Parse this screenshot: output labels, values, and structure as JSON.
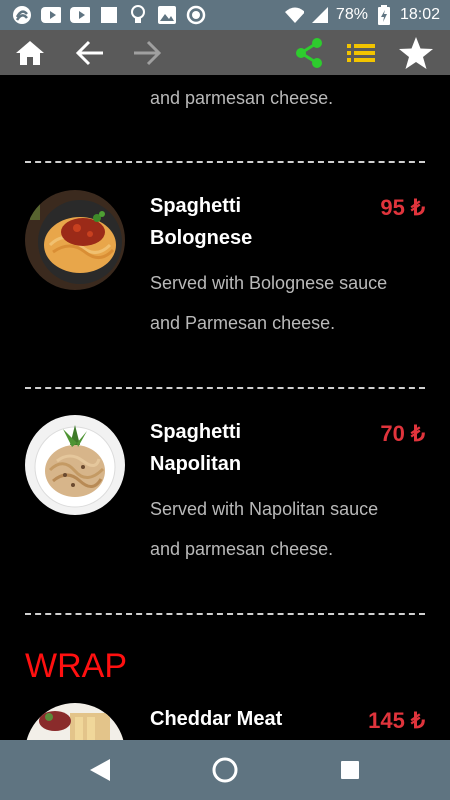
{
  "status_bar": {
    "battery": "78%",
    "time": "18:02"
  },
  "toolbar": {
    "icons": [
      "home-icon",
      "back-arrow-icon",
      "forward-arrow-icon",
      "share-icon",
      "list-icon",
      "star-icon"
    ],
    "colors": {
      "share": "#2ecc2e",
      "list": "#f2c400",
      "icon": "#ffffff",
      "disabled": "#a0a0a0"
    }
  },
  "menu": {
    "prev_item_desc_tail": "and parmesan cheese.",
    "items": [
      {
        "name_line1": "Spaghetti",
        "name_line2": "Bolognese",
        "price": "95 ₺",
        "desc_line1": "Served with Bolognese sauce",
        "desc_line2": "and Parmesan cheese."
      },
      {
        "name_line1": "Spaghetti",
        "name_line2": "Napolitan",
        "price": "70 ₺",
        "desc_line1": "Served with Napolitan sauce",
        "desc_line2": "and parmesan cheese."
      }
    ],
    "section_wrap": {
      "title": "WRAP",
      "first_item": {
        "name_line1": "Cheddar Meat",
        "price": "145 ₺"
      }
    }
  },
  "nav_bar": {
    "icons": [
      "back-triangle-icon",
      "home-circle-icon",
      "recents-square-icon"
    ]
  }
}
